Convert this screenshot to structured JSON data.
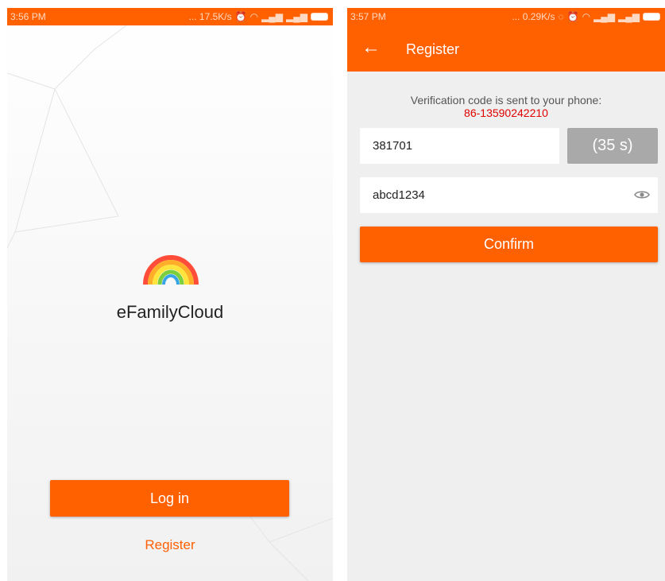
{
  "left": {
    "status_bar": {
      "time": "3:56 PM",
      "net_speed": "... 17.5K/s",
      "icons": [
        "alarm-icon",
        "wifi-icon",
        "signal-icon",
        "signal-icon",
        "battery-icon"
      ]
    },
    "app_name": "eFamilyCloud",
    "login_label": "Log in",
    "register_label": "Register"
  },
  "right": {
    "status_bar": {
      "time": "3:57 PM",
      "net_speed": "... 0.29K/s",
      "icons": [
        "sync-icon",
        "alarm-icon",
        "wifi-icon",
        "signal-icon",
        "signal-icon",
        "battery-icon"
      ]
    },
    "header_title": "Register",
    "message": "Verification code is sent to your phone:",
    "phone": "86-13590242210",
    "code_value": "381701",
    "countdown": "(35 s)",
    "password_value": "abcd1234",
    "confirm_label": "Confirm"
  },
  "colors": {
    "accent": "#ff6000",
    "phone_text": "#e00000",
    "disabled_button": "#a9a9a9"
  }
}
